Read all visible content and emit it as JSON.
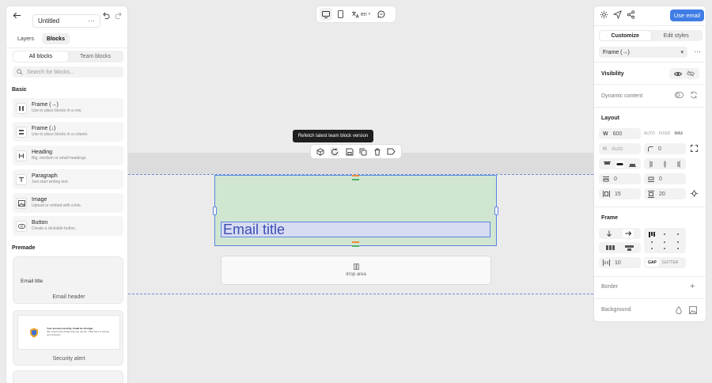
{
  "doc": {
    "title": "Untitled"
  },
  "left": {
    "tabs": [
      "Layers",
      "Blocks"
    ],
    "filter": [
      "All blocks",
      "Team blocks"
    ],
    "search_placeholder": "Search for blocks...",
    "basic_heading": "Basic",
    "blocks": [
      {
        "title": "Frame (→)",
        "desc": "Use to place blocks in a row.",
        "icon": "frame-row-icon"
      },
      {
        "title": "Frame (↓)",
        "desc": "Use to place blocks in a column.",
        "icon": "frame-column-icon"
      },
      {
        "title": "Heading",
        "desc": "Big, medium or small headings.",
        "icon": "heading-icon"
      },
      {
        "title": "Paragraph",
        "desc": "Just start writing text.",
        "icon": "paragraph-icon"
      },
      {
        "title": "Image",
        "desc": "Upload or embed with a link.",
        "icon": "image-icon"
      },
      {
        "title": "Button",
        "desc": "Create a clickable button.",
        "icon": "button-icon"
      }
    ],
    "premade_heading": "Premade",
    "premade": [
      {
        "preview_title": "Email title",
        "label": "Email header"
      },
      {
        "preview_title": "Your account security. Could be stronger",
        "preview_body": "We noted a few things that you can do. Click here to secure your account.",
        "label": "Security alert"
      }
    ]
  },
  "topbar": {
    "lang": "en"
  },
  "canvas": {
    "tooltip": "Refetch latest team block version",
    "email_title": "Email title",
    "drop_area": "drop area"
  },
  "right": {
    "use_email": "Use email",
    "tabs": [
      "Customize",
      "Edit styles"
    ],
    "selector": "Frame (→)",
    "visibility": "Visibility",
    "dynamic_content": "Dynamic content",
    "layout": "Layout",
    "w_label": "W",
    "w_value": "600",
    "w_modes": [
      "AUTO",
      "FIXED",
      "MAX"
    ],
    "h_label": "H",
    "h_value": "Auto",
    "radius": "0",
    "pad_a": "0",
    "pad_b": "0",
    "pad_c": "15",
    "pad_d": "20",
    "frame": "Frame",
    "gap_value": "10",
    "gap": "GAP",
    "gutter": "GUTTER",
    "border": "Border",
    "background": "Background"
  },
  "colors": {
    "accent": "#3f7de5",
    "selection": "#5a84e0",
    "frame_fill": "#b9e2bb"
  }
}
